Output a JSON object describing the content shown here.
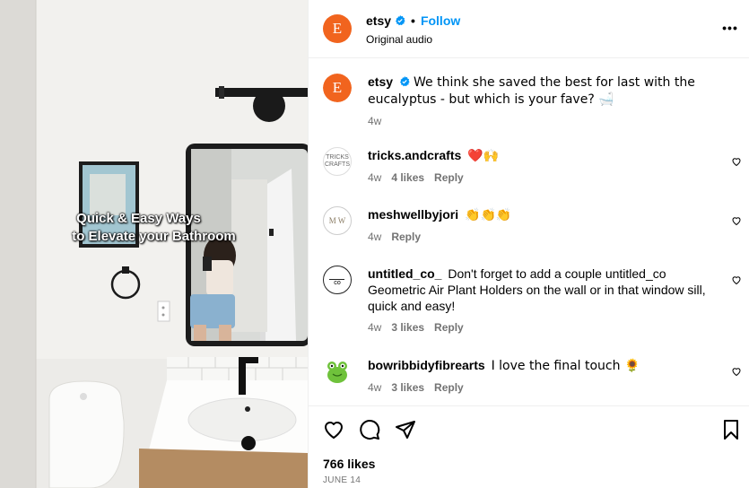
{
  "media": {
    "overlay_line1": "Quick & Easy Ways",
    "overlay_line2": "to Elevate your Bathroom"
  },
  "header": {
    "username": "etsy",
    "follow_label": "Follow",
    "subtitle": "Original audio",
    "avatar_letter": "E",
    "more_label": "•••"
  },
  "caption": {
    "username": "etsy",
    "text": "We think she saved the best for last with the eucalyptus - but which is your fave? 🛁",
    "time": "4w"
  },
  "comments": [
    {
      "username": "tricks.andcrafts",
      "text": "❤️🙌",
      "time": "4w",
      "likes": "4 likes",
      "reply": "Reply"
    },
    {
      "username": "meshwellbyjori",
      "text": "👏👏👏",
      "time": "4w",
      "likes": "",
      "reply": "Reply"
    },
    {
      "username": "untitled_co_",
      "text": "Don't forget to add a couple untitled_co Geometric Air Plant Holders on the wall or in that window sill, quick and easy!",
      "time": "4w",
      "likes": "3 likes",
      "reply": "Reply"
    },
    {
      "username": "bowribbidyfibrearts",
      "text": "I love the final touch 🌻",
      "time": "4w",
      "likes": "3 likes",
      "reply": "Reply"
    }
  ],
  "avatars": {
    "tricks": "TRICKS CRAFTS",
    "mesh": "M W",
    "untitled": "CO"
  },
  "footer": {
    "likes": "766 likes",
    "date": "JUNE 14"
  },
  "colors": {
    "accent": "#0095f6",
    "etsy_orange": "#f1641e",
    "heart_red": "#e0245e"
  }
}
